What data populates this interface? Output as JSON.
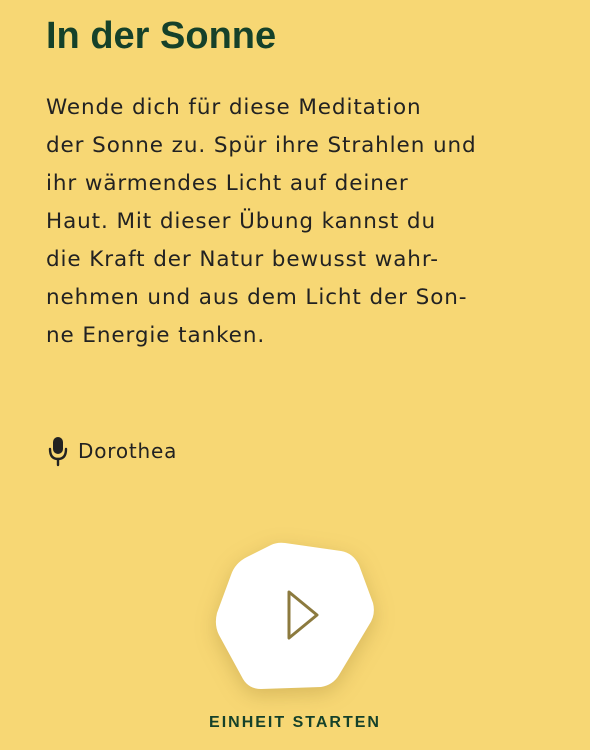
{
  "title": "In der Sonne",
  "description_lines": [
    "Wende dich für diese Meditation",
    "der Sonne zu. Spür ihre Strahlen und",
    "ihr wärmendes Licht auf deiner",
    "Haut. Mit dieser Übung kannst du",
    "die Kraft der Natur bewusst wahr-",
    "nehmen und aus dem Licht der Son-",
    "ne Energie tanken."
  ],
  "narrator": {
    "icon": "microphone-icon",
    "name": "Dorothea"
  },
  "play_button": {
    "icon": "play-icon"
  },
  "start_label": "EINHEIT STARTEN",
  "colors": {
    "background": "#F7D774",
    "title": "#15412A",
    "text": "#222222",
    "button": "#FFFFFF",
    "play_icon": "#8C7A3E"
  }
}
